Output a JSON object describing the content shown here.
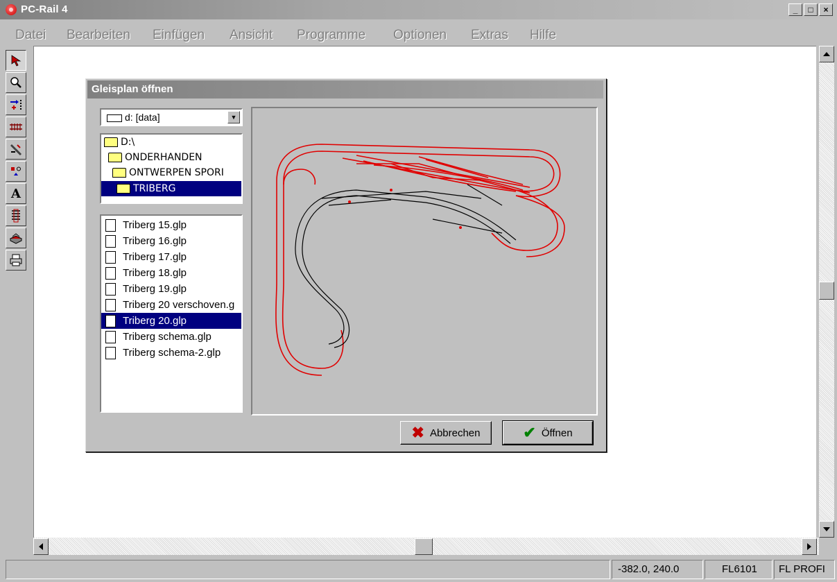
{
  "window": {
    "title": "PC-Rail 4",
    "btn_min": "_",
    "btn_max": "□",
    "btn_close": "×"
  },
  "menu": [
    {
      "label": "Datei",
      "id": "datei"
    },
    {
      "label": "Bearbeiten",
      "id": "bearbeiten"
    },
    {
      "label": "Einfügen",
      "id": "einfuegen"
    },
    {
      "label": "Ansicht",
      "id": "ansicht"
    },
    {
      "label": "Programme",
      "id": "programme"
    },
    {
      "label": "Optionen",
      "id": "optionen"
    },
    {
      "label": "Extras",
      "id": "extras"
    },
    {
      "label": "Hilfe",
      "id": "hilfe"
    }
  ],
  "toolbar": {
    "icons": [
      "select-arrow-icon",
      "zoom-icon",
      "move-track-icon",
      "track-icon",
      "tool-icon",
      "signal-icon",
      "text-icon",
      "layers-icon",
      "3d-view-icon",
      "print-icon"
    ],
    "text_tool": "A"
  },
  "dialog": {
    "title": "Gleisplan öffnen",
    "drive": "d: [data]",
    "dirs": [
      {
        "label": "D:\\",
        "selected": false
      },
      {
        "label": "ONDERHANDEN",
        "selected": false
      },
      {
        "label": "ONTWERPEN SPORI",
        "selected": false
      },
      {
        "label": "TRIBERG",
        "selected": true
      }
    ],
    "files": [
      {
        "label": "Triberg 15.glp",
        "selected": false
      },
      {
        "label": "Triberg 16.glp",
        "selected": false
      },
      {
        "label": "Triberg 17.glp",
        "selected": false
      },
      {
        "label": "Triberg 18.glp",
        "selected": false
      },
      {
        "label": "Triberg 19.glp",
        "selected": false
      },
      {
        "label": "Triberg 20 verschoven.g",
        "selected": false
      },
      {
        "label": "Triberg 20.glp",
        "selected": true
      },
      {
        "label": "Triberg schema.glp",
        "selected": false
      },
      {
        "label": "Triberg schema-2.glp",
        "selected": false
      }
    ],
    "cancel_label": "Abbrechen",
    "open_label": "Öffnen",
    "colors": {
      "track_red": "#e00000",
      "track_black": "#000000"
    }
  },
  "status": {
    "coords": "-382.0, 240.0",
    "model": "FL6101",
    "profile": "FL PROFI"
  }
}
